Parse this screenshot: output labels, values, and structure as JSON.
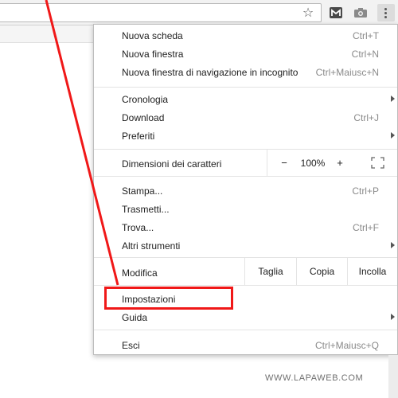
{
  "browser": {
    "bookmark_icon": "star-outline-icon",
    "extension_icon": "m-extension-icon",
    "camera_icon": "camera-icon",
    "menu_icon": "three-dots-vertical-icon"
  },
  "menu": {
    "group1": [
      {
        "label": "Nuova scheda",
        "shortcut": "Ctrl+T"
      },
      {
        "label": "Nuova finestra",
        "shortcut": "Ctrl+N"
      },
      {
        "label": "Nuova finestra di navigazione in incognito",
        "shortcut": "Ctrl+Maiusc+N"
      }
    ],
    "group2": [
      {
        "label": "Cronologia",
        "shortcut": "",
        "submenu": true
      },
      {
        "label": "Download",
        "shortcut": "Ctrl+J"
      },
      {
        "label": "Preferiti",
        "shortcut": "",
        "submenu": true
      }
    ],
    "zoom": {
      "label": "Dimensioni dei caratteri",
      "minus": "−",
      "value": "100%",
      "plus": "+",
      "fullscreen_icon": "fullscreen-icon"
    },
    "group3": [
      {
        "label": "Stampa...",
        "shortcut": "Ctrl+P"
      },
      {
        "label": "Trasmetti...",
        "shortcut": ""
      },
      {
        "label": "Trova...",
        "shortcut": "Ctrl+F"
      },
      {
        "label": "Altri strumenti",
        "shortcut": "",
        "submenu": true
      }
    ],
    "edit": {
      "label": "Modifica",
      "cut": "Taglia",
      "copy": "Copia",
      "paste": "Incolla"
    },
    "group4": [
      {
        "label": "Impostazioni",
        "shortcut": ""
      },
      {
        "label": "Guida",
        "shortcut": "",
        "submenu": true
      }
    ],
    "group5": [
      {
        "label": "Esci",
        "shortcut": "Ctrl+Maiusc+Q"
      }
    ]
  },
  "annotation": {
    "color": "#f01818",
    "target": "Impostazioni"
  },
  "watermark": "WWW.LAPAWEB.COM"
}
